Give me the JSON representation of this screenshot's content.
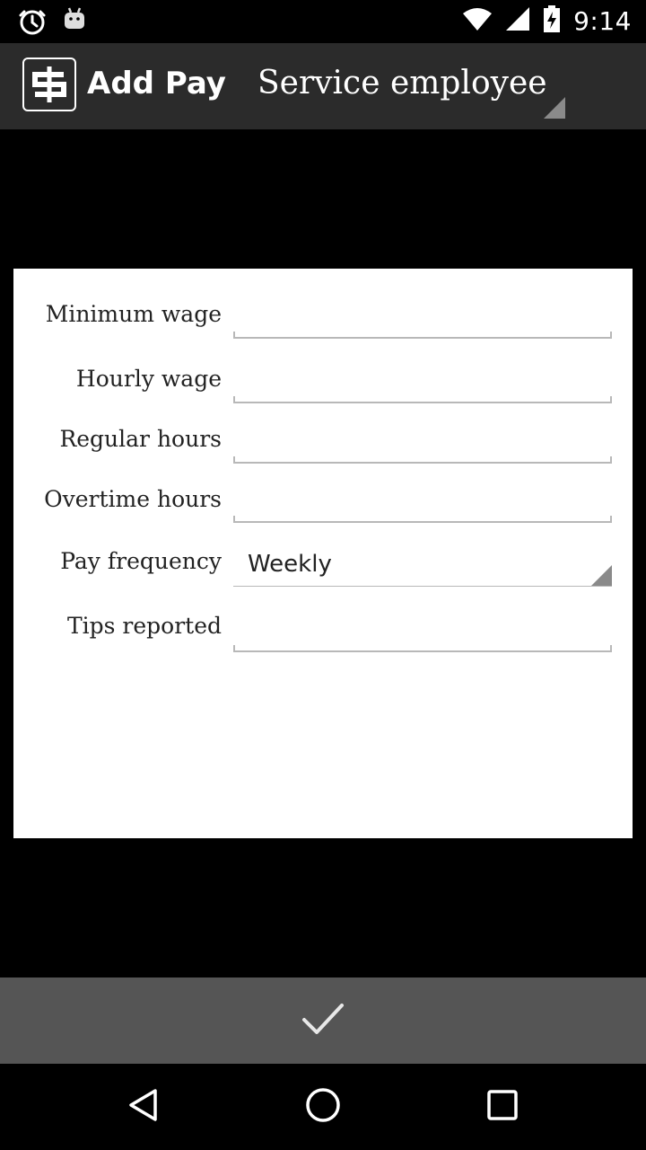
{
  "status_bar": {
    "time": "9:14",
    "icons": [
      "alarm-icon",
      "android-icon",
      "wifi-icon",
      "signal-icon",
      "battery-charging-icon"
    ]
  },
  "action_bar": {
    "title": "Add Pay",
    "logo_icon": "dollar-logo-icon",
    "employee_type": "Service employee"
  },
  "form": {
    "fields": [
      {
        "label": "Minimum wage",
        "value": ""
      },
      {
        "label": "Hourly wage",
        "value": ""
      },
      {
        "label": "Regular hours",
        "value": ""
      },
      {
        "label": "Overtime hours",
        "value": ""
      },
      {
        "label": "Pay frequency",
        "value": "Weekly"
      },
      {
        "label": "Tips reported",
        "value": ""
      }
    ]
  },
  "confirm_bar": {
    "icon": "checkmark-icon"
  },
  "nav_bar": {
    "icons": [
      "back-icon",
      "home-icon",
      "recents-icon"
    ]
  },
  "colors": {
    "action_bar_bg": "#2b2b2b",
    "confirm_bar_bg": "#555555",
    "card_bg": "#ffffff",
    "underline": "#b8b8b8"
  }
}
